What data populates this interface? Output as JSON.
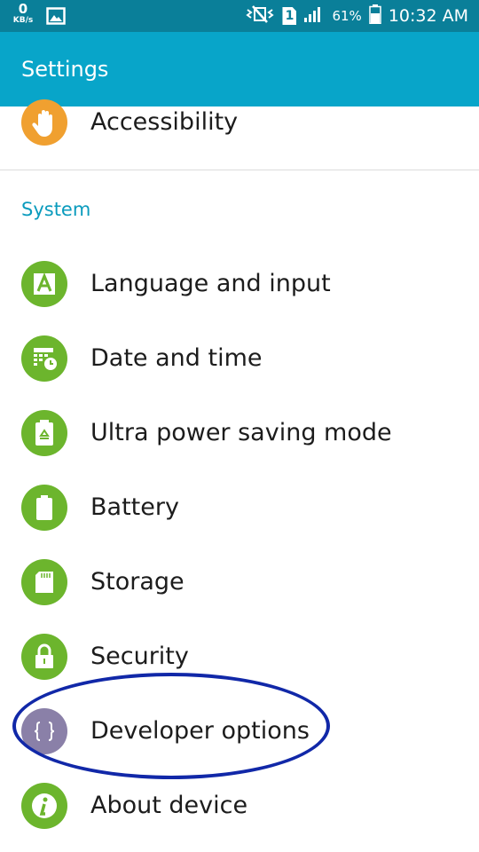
{
  "status_bar": {
    "network_speed": "0",
    "network_speed_unit": "KB/s",
    "sim_slot": "1",
    "battery_percent": "61%",
    "time": "10:32 AM"
  },
  "app_bar": {
    "title": "Settings"
  },
  "accessibility": {
    "label": "Accessibility",
    "icon": "hand-icon"
  },
  "system_section": {
    "header": "System",
    "items": [
      {
        "label": "Language and input",
        "icon": "language-a-icon"
      },
      {
        "label": "Date and time",
        "icon": "calendar-clock-icon"
      },
      {
        "label": "Ultra power saving mode",
        "icon": "battery-recycle-icon"
      },
      {
        "label": "Battery",
        "icon": "battery-icon"
      },
      {
        "label": "Storage",
        "icon": "sd-card-icon"
      },
      {
        "label": "Security",
        "icon": "lock-icon"
      },
      {
        "label": "Developer options",
        "icon": "curly-braces-icon"
      },
      {
        "label": "About device",
        "icon": "info-icon"
      }
    ]
  },
  "colors": {
    "status_bar": "#0a7f99",
    "app_bar": "#08a5c9",
    "section_header": "#0a9bbd",
    "icon_green": "#6cb52d",
    "icon_orange": "#f0a030",
    "icon_purple": "#8a80a8",
    "highlight_ring": "#1128a8"
  }
}
